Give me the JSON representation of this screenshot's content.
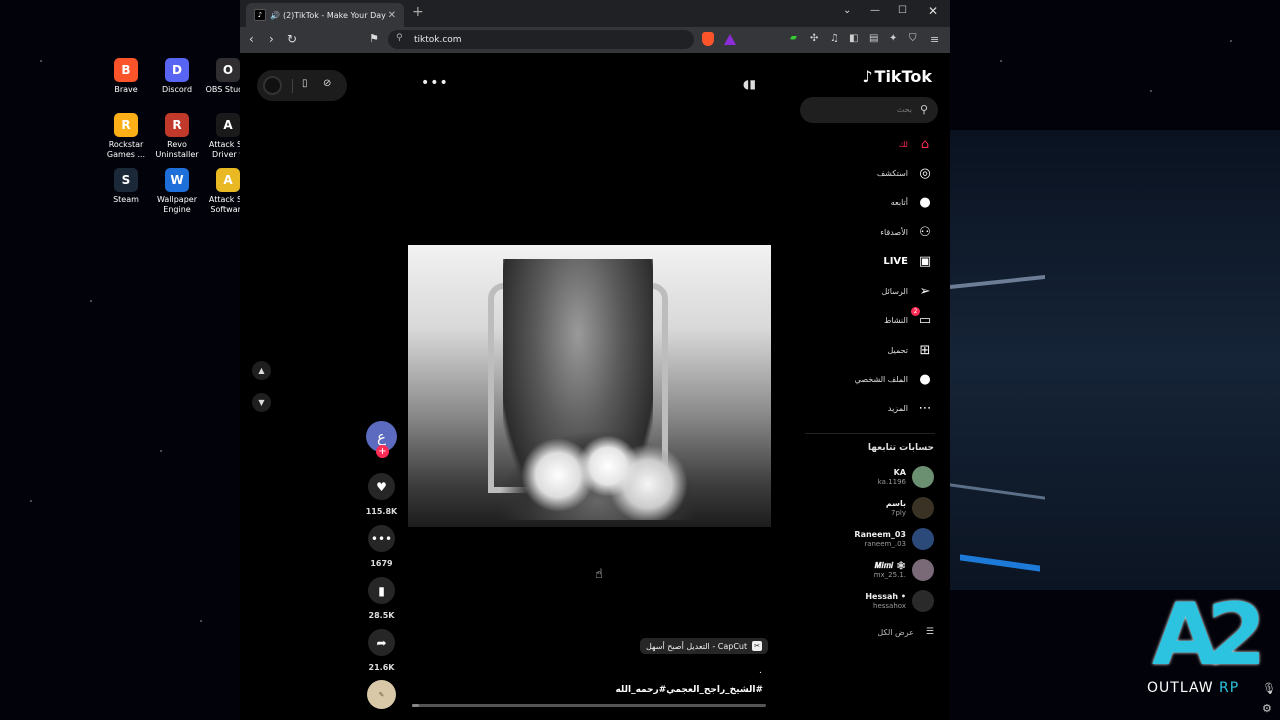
{
  "desktop": {
    "icons": [
      {
        "label": "Brave",
        "color": "#fb542b",
        "glyph": "B"
      },
      {
        "label": "Discord",
        "color": "#5865f2",
        "glyph": "D"
      },
      {
        "label": "OBS Studio",
        "color": "#302e31",
        "glyph": "O"
      },
      {
        "label": "Rockstar Games ...",
        "color": "#fcaf17",
        "glyph": "R"
      },
      {
        "label": "Revo Uninstaller",
        "color": "#c0392b",
        "glyph": "R"
      },
      {
        "label": "Attack Sh Driver v",
        "color": "#1a1a1a",
        "glyph": "A"
      },
      {
        "label": "Steam",
        "color": "#1b2838",
        "glyph": "S"
      },
      {
        "label": "Wallpaper Engine",
        "color": "#1e6fd9",
        "glyph": "W"
      },
      {
        "label": "Attack Sh Software",
        "color": "#e8b923",
        "glyph": "A"
      }
    ],
    "watermark": {
      "big": "A2",
      "text": "OUTLAW",
      "text2": "RP"
    }
  },
  "browser": {
    "tab_title": "(2)TikTok - Make Your Day",
    "url": "tiktok.com",
    "accent": "#fe2c55"
  },
  "video": {
    "capcut_badge": "CapCut - التعديل أصبح أسهل",
    "caption": "#الشيخ_راجح_العجمي#رحمه_الله",
    "dot": ".",
    "progress": 0.02
  },
  "actions": {
    "avatar_letter": "ع",
    "likes": "115.8K",
    "comments": "1679",
    "saves": "28.5K",
    "shares": "21.6K"
  },
  "sidebar": {
    "logo": "TikTok",
    "search_placeholder": "بحث",
    "nav": [
      {
        "label": "لك",
        "icon": "home-icon",
        "glyph": "⌂",
        "active": true
      },
      {
        "label": "استكشف",
        "icon": "compass-icon",
        "glyph": "◎"
      },
      {
        "label": "أتابعه",
        "icon": "following-avatar-icon",
        "glyph": "●"
      },
      {
        "label": "الأصدقاء",
        "icon": "friends-icon",
        "glyph": "⚇"
      },
      {
        "label": "LIVE",
        "icon": "live-icon",
        "glyph": "▣"
      },
      {
        "label": "الرسائل",
        "icon": "messages-icon",
        "glyph": "➢"
      },
      {
        "label": "النشاط",
        "icon": "activity-icon",
        "glyph": "▭",
        "badge": "2"
      },
      {
        "label": "تحميل",
        "icon": "upload-icon",
        "glyph": "⊞"
      },
      {
        "label": "الملف الشخصي",
        "icon": "profile-avatar-icon",
        "glyph": "●"
      },
      {
        "label": "المزيد",
        "icon": "more-icon",
        "glyph": "⋯"
      }
    ],
    "following_header": "حسابات تتابعها",
    "accounts": [
      {
        "name": "KA",
        "user": "ka.1196",
        "color": "#6b8f71"
      },
      {
        "name": "باسم",
        "user": "7ply",
        "color": "#3a3224"
      },
      {
        "name": "Raneem_03",
        "user": "raneem_.03",
        "color": "#2b4a7a"
      },
      {
        "name": "𝑴𝒊𝒎𝒊 🕸",
        "user": "mx_25.1.",
        "color": "#7a6a78"
      },
      {
        "name": "Hessah •",
        "user": "hessahox",
        "color": "#2a2a2a"
      }
    ],
    "see_all": "عرض الكل"
  }
}
